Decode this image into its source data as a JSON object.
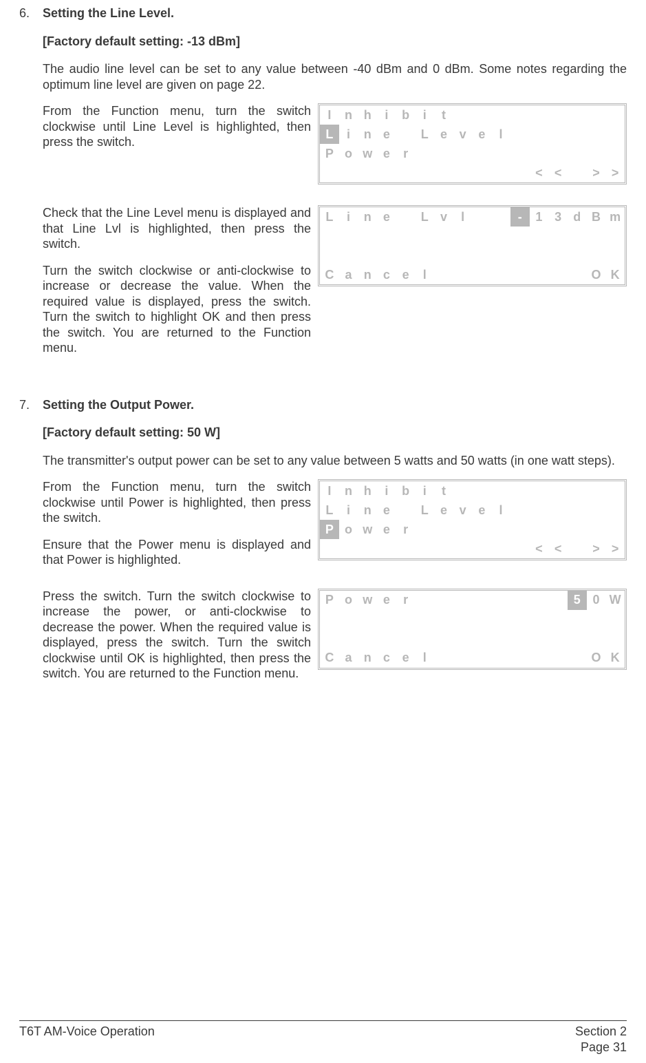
{
  "section6": {
    "num": "6.",
    "title": "Setting the Line Level.",
    "default": "[Factory default setting: -13 dBm]",
    "intro": "The audio line level can be set to any value between -40 dBm and 0 dBm. Some notes regarding the optimum line level are given on page 22.",
    "step1": "From the Function menu, turn the switch clockwise until Line Level is highlighted, then press the switch.",
    "step2a": "Check that the Line Level menu is displayed and that Line Lvl is highlighted, then press the switch.",
    "step2b": "Turn the switch clockwise or anti-clockwise to increase or decrease the value. When the required value is displayed, press the switch. Turn the switch to highlight OK and then press the switch. You are returned to the Function menu."
  },
  "section7": {
    "num": "7.",
    "title": "Setting the Output Power.",
    "default": "[Factory default setting: 50 W]",
    "intro": "The transmitter's output power can be set to any value between 5 watts and 50 watts (in one watt steps).",
    "step1a": "From the Function menu, turn the switch clockwise until Power is highlighted, then press the switch.",
    "step1b": "Ensure that the Power menu is displayed and that Power is highlighted.",
    "step2": "Press the switch. Turn the switch clockwise to increase the power, or anti-clockwise to decrease the power. When the required value is displayed, press the switch. Turn the switch clockwise until OK is highlighted, then press the switch. You are returned to the Function menu."
  },
  "lcd1": [
    [
      {
        "t": "I"
      },
      {
        "t": "n"
      },
      {
        "t": "h"
      },
      {
        "t": "i"
      },
      {
        "t": "b"
      },
      {
        "t": "i"
      },
      {
        "t": "t"
      },
      {
        "t": ""
      },
      {
        "t": ""
      },
      {
        "t": ""
      },
      {
        "t": ""
      },
      {
        "t": ""
      },
      {
        "t": ""
      },
      {
        "t": ""
      },
      {
        "t": ""
      },
      {
        "t": ""
      }
    ],
    [
      {
        "t": "L",
        "hl": true
      },
      {
        "t": "i"
      },
      {
        "t": "n"
      },
      {
        "t": "e"
      },
      {
        "t": ""
      },
      {
        "t": "L"
      },
      {
        "t": "e"
      },
      {
        "t": "v"
      },
      {
        "t": "e"
      },
      {
        "t": "l"
      },
      {
        "t": ""
      },
      {
        "t": ""
      },
      {
        "t": ""
      },
      {
        "t": ""
      },
      {
        "t": ""
      },
      {
        "t": ""
      }
    ],
    [
      {
        "t": "P"
      },
      {
        "t": "o"
      },
      {
        "t": "w"
      },
      {
        "t": "e"
      },
      {
        "t": "r"
      },
      {
        "t": ""
      },
      {
        "t": ""
      },
      {
        "t": ""
      },
      {
        "t": ""
      },
      {
        "t": ""
      },
      {
        "t": ""
      },
      {
        "t": ""
      },
      {
        "t": ""
      },
      {
        "t": ""
      },
      {
        "t": ""
      },
      {
        "t": ""
      }
    ],
    [
      {
        "t": ""
      },
      {
        "t": ""
      },
      {
        "t": ""
      },
      {
        "t": ""
      },
      {
        "t": ""
      },
      {
        "t": ""
      },
      {
        "t": ""
      },
      {
        "t": ""
      },
      {
        "t": ""
      },
      {
        "t": ""
      },
      {
        "t": ""
      },
      {
        "t": "<"
      },
      {
        "t": "<"
      },
      {
        "t": ""
      },
      {
        "t": ">"
      },
      {
        "t": ">"
      }
    ]
  ],
  "lcd2": [
    [
      {
        "t": "L"
      },
      {
        "t": "i"
      },
      {
        "t": "n"
      },
      {
        "t": "e"
      },
      {
        "t": ""
      },
      {
        "t": "L"
      },
      {
        "t": "v"
      },
      {
        "t": "l"
      },
      {
        "t": ""
      },
      {
        "t": ""
      },
      {
        "t": "-",
        "hl": true
      },
      {
        "t": "1"
      },
      {
        "t": "3"
      },
      {
        "t": "d"
      },
      {
        "t": "B"
      },
      {
        "t": "m"
      }
    ],
    [
      {
        "t": ""
      },
      {
        "t": ""
      },
      {
        "t": ""
      },
      {
        "t": ""
      },
      {
        "t": ""
      },
      {
        "t": ""
      },
      {
        "t": ""
      },
      {
        "t": ""
      },
      {
        "t": ""
      },
      {
        "t": ""
      },
      {
        "t": ""
      },
      {
        "t": ""
      },
      {
        "t": ""
      },
      {
        "t": ""
      },
      {
        "t": ""
      },
      {
        "t": ""
      }
    ],
    [
      {
        "t": ""
      },
      {
        "t": ""
      },
      {
        "t": ""
      },
      {
        "t": ""
      },
      {
        "t": ""
      },
      {
        "t": ""
      },
      {
        "t": ""
      },
      {
        "t": ""
      },
      {
        "t": ""
      },
      {
        "t": ""
      },
      {
        "t": ""
      },
      {
        "t": ""
      },
      {
        "t": ""
      },
      {
        "t": ""
      },
      {
        "t": ""
      },
      {
        "t": ""
      }
    ],
    [
      {
        "t": "C"
      },
      {
        "t": "a"
      },
      {
        "t": "n"
      },
      {
        "t": "c"
      },
      {
        "t": "e"
      },
      {
        "t": "l"
      },
      {
        "t": ""
      },
      {
        "t": ""
      },
      {
        "t": ""
      },
      {
        "t": ""
      },
      {
        "t": ""
      },
      {
        "t": ""
      },
      {
        "t": ""
      },
      {
        "t": ""
      },
      {
        "t": "O"
      },
      {
        "t": "K"
      }
    ]
  ],
  "lcd3": [
    [
      {
        "t": "I"
      },
      {
        "t": "n"
      },
      {
        "t": "h"
      },
      {
        "t": "i"
      },
      {
        "t": "b"
      },
      {
        "t": "i"
      },
      {
        "t": "t"
      },
      {
        "t": ""
      },
      {
        "t": ""
      },
      {
        "t": ""
      },
      {
        "t": ""
      },
      {
        "t": ""
      },
      {
        "t": ""
      },
      {
        "t": ""
      },
      {
        "t": ""
      },
      {
        "t": ""
      }
    ],
    [
      {
        "t": "L"
      },
      {
        "t": "i"
      },
      {
        "t": "n"
      },
      {
        "t": "e"
      },
      {
        "t": ""
      },
      {
        "t": "L"
      },
      {
        "t": "e"
      },
      {
        "t": "v"
      },
      {
        "t": "e"
      },
      {
        "t": "l"
      },
      {
        "t": ""
      },
      {
        "t": ""
      },
      {
        "t": ""
      },
      {
        "t": ""
      },
      {
        "t": ""
      },
      {
        "t": ""
      }
    ],
    [
      {
        "t": "P",
        "hl": true
      },
      {
        "t": "o"
      },
      {
        "t": "w"
      },
      {
        "t": "e"
      },
      {
        "t": "r"
      },
      {
        "t": ""
      },
      {
        "t": ""
      },
      {
        "t": ""
      },
      {
        "t": ""
      },
      {
        "t": ""
      },
      {
        "t": ""
      },
      {
        "t": ""
      },
      {
        "t": ""
      },
      {
        "t": ""
      },
      {
        "t": ""
      },
      {
        "t": ""
      }
    ],
    [
      {
        "t": ""
      },
      {
        "t": ""
      },
      {
        "t": ""
      },
      {
        "t": ""
      },
      {
        "t": ""
      },
      {
        "t": ""
      },
      {
        "t": ""
      },
      {
        "t": ""
      },
      {
        "t": ""
      },
      {
        "t": ""
      },
      {
        "t": ""
      },
      {
        "t": "<"
      },
      {
        "t": "<"
      },
      {
        "t": ""
      },
      {
        "t": ">"
      },
      {
        "t": ">"
      }
    ]
  ],
  "lcd4": [
    [
      {
        "t": "P"
      },
      {
        "t": "o"
      },
      {
        "t": "w"
      },
      {
        "t": "e"
      },
      {
        "t": "r"
      },
      {
        "t": ""
      },
      {
        "t": ""
      },
      {
        "t": ""
      },
      {
        "t": ""
      },
      {
        "t": ""
      },
      {
        "t": ""
      },
      {
        "t": ""
      },
      {
        "t": ""
      },
      {
        "t": "5",
        "hl": true
      },
      {
        "t": "0"
      },
      {
        "t": "W"
      }
    ],
    [
      {
        "t": ""
      },
      {
        "t": ""
      },
      {
        "t": ""
      },
      {
        "t": ""
      },
      {
        "t": ""
      },
      {
        "t": ""
      },
      {
        "t": ""
      },
      {
        "t": ""
      },
      {
        "t": ""
      },
      {
        "t": ""
      },
      {
        "t": ""
      },
      {
        "t": ""
      },
      {
        "t": ""
      },
      {
        "t": ""
      },
      {
        "t": ""
      },
      {
        "t": ""
      }
    ],
    [
      {
        "t": ""
      },
      {
        "t": ""
      },
      {
        "t": ""
      },
      {
        "t": ""
      },
      {
        "t": ""
      },
      {
        "t": ""
      },
      {
        "t": ""
      },
      {
        "t": ""
      },
      {
        "t": ""
      },
      {
        "t": ""
      },
      {
        "t": ""
      },
      {
        "t": ""
      },
      {
        "t": ""
      },
      {
        "t": ""
      },
      {
        "t": ""
      },
      {
        "t": ""
      }
    ],
    [
      {
        "t": "C"
      },
      {
        "t": "a"
      },
      {
        "t": "n"
      },
      {
        "t": "c"
      },
      {
        "t": "e"
      },
      {
        "t": "l"
      },
      {
        "t": ""
      },
      {
        "t": ""
      },
      {
        "t": ""
      },
      {
        "t": ""
      },
      {
        "t": ""
      },
      {
        "t": ""
      },
      {
        "t": ""
      },
      {
        "t": ""
      },
      {
        "t": "O"
      },
      {
        "t": "K"
      }
    ]
  ],
  "footer": {
    "left": "T6T AM-Voice Operation",
    "right1": "Section 2",
    "right2": "Page 31"
  }
}
